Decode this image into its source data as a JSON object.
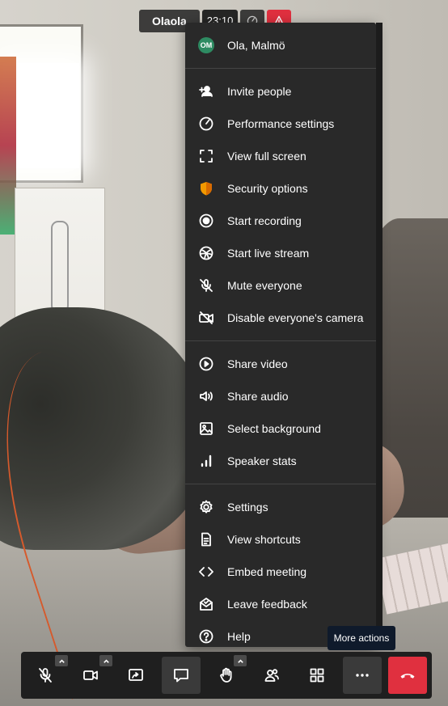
{
  "top": {
    "participant_name": "Olaola",
    "timer": "23:10"
  },
  "menu": {
    "profile": {
      "initials": "OM",
      "name": "Ola, Malmö"
    },
    "group1": [
      {
        "label": "Invite people",
        "icon": "add-person-icon"
      },
      {
        "label": "Performance settings",
        "icon": "gauge-icon"
      },
      {
        "label": "View full screen",
        "icon": "fullscreen-icon"
      },
      {
        "label": "Security options",
        "icon": "shield-icon"
      },
      {
        "label": "Start recording",
        "icon": "record-icon"
      },
      {
        "label": "Start live stream",
        "icon": "live-stream-icon"
      },
      {
        "label": "Mute everyone",
        "icon": "mic-off-icon"
      },
      {
        "label": "Disable everyone's camera",
        "icon": "camera-off-icon"
      }
    ],
    "group2": [
      {
        "label": "Share video",
        "icon": "play-circle-icon"
      },
      {
        "label": "Share audio",
        "icon": "speaker-icon"
      },
      {
        "label": "Select background",
        "icon": "image-icon"
      },
      {
        "label": "Speaker stats",
        "icon": "bar-chart-icon"
      }
    ],
    "group3": [
      {
        "label": "Settings",
        "icon": "gear-icon"
      },
      {
        "label": "View shortcuts",
        "icon": "document-icon"
      },
      {
        "label": "Embed meeting",
        "icon": "code-icon"
      },
      {
        "label": "Leave feedback",
        "icon": "feedback-icon"
      },
      {
        "label": "Help",
        "icon": "help-icon"
      }
    ]
  },
  "tooltip": {
    "text": "More actions"
  },
  "toolbar": {
    "buttons": [
      "mic-off-icon",
      "camera-icon",
      "screen-share-icon",
      "chat-icon",
      "raise-hand-icon",
      "participants-icon",
      "tile-view-icon",
      "more-icon",
      "hangup-icon"
    ]
  },
  "colors": {
    "menu_bg": "#292929",
    "toolbar_bg": "#1f1f1f",
    "hangup": "#e0303f",
    "avatar": "#2e8b62",
    "shield": "#f29900"
  }
}
